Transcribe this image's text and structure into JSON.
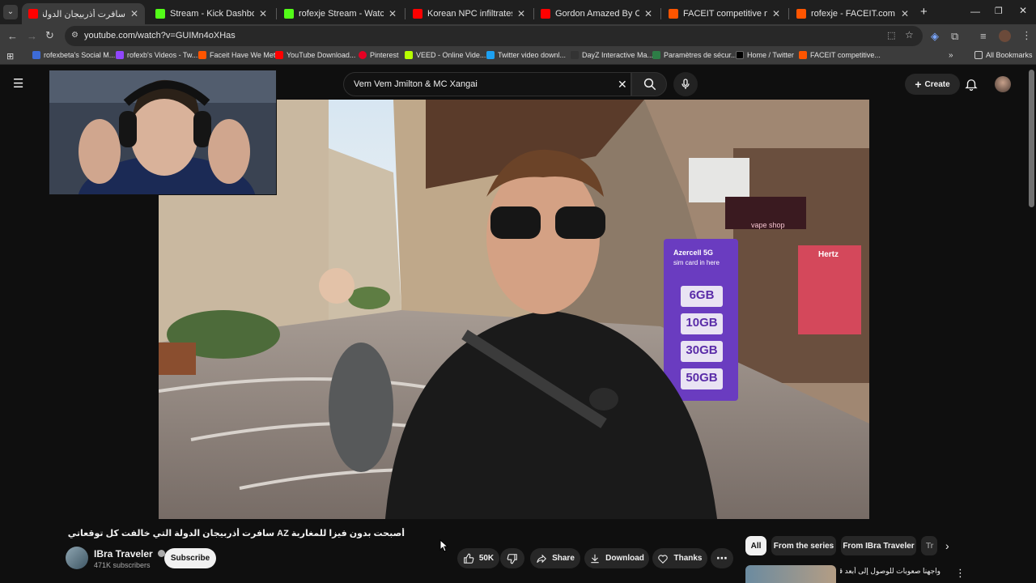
{
  "browser": {
    "tabs": [
      {
        "title": "سافرت أذربيجان الدولة التي خالف",
        "favicon_color": "#ff0000",
        "active": true
      },
      {
        "title": "Stream - Kick Dashboard",
        "favicon_color": "#53fc18",
        "active": false
      },
      {
        "title": "rofexje Stream - Watch Live on",
        "favicon_color": "#53fc18",
        "active": false
      },
      {
        "title": "Korean NPC infiltrates Sony HQ",
        "favicon_color": "#ff0000",
        "active": false
      },
      {
        "title": "Gordon Amazed By Chef Who H",
        "favicon_color": "#ff0000",
        "active": false
      },
      {
        "title": "FACEIT competitive match - FA",
        "favicon_color": "#ff5500",
        "active": false
      },
      {
        "title": "rofexje - FACEIT.com",
        "favicon_color": "#ff5500",
        "active": false
      }
    ],
    "new_tab_label": "+",
    "url": "youtube.com/watch?v=GUIMn4oXHas",
    "bookmarks": [
      {
        "label": "rofexbeta's Social M...",
        "color": "#3d6bd6"
      },
      {
        "label": "rofexb's Videos - Tw...",
        "color": "#9146ff"
      },
      {
        "label": "Faceit Have We Met",
        "color": "#ff5500"
      },
      {
        "label": "YouTube Download...",
        "color": "#ff0000"
      },
      {
        "label": "Pinterest",
        "color": "#e60023"
      },
      {
        "label": "VEED - Online Vide...",
        "color": "#b6ff00"
      },
      {
        "label": "Twitter video downl...",
        "color": "#1da1f2"
      },
      {
        "label": "DayZ Interactive Ma...",
        "color": "#333333"
      },
      {
        "label": "Paramètres de sécur...",
        "color": "#2d7d46"
      },
      {
        "label": "Home / Twitter",
        "color": "#000000"
      },
      {
        "label": "FACEIT competitive...",
        "color": "#ff5500"
      }
    ],
    "all_bookmarks": "All Bookmarks"
  },
  "youtube": {
    "search_query": "Vem Vem Jmilton & MC Xangai",
    "create_label": "Create",
    "video_overlay": {
      "sign_sizes": [
        "6GB",
        "10GB",
        "30GB",
        "50GB"
      ],
      "brand_sign": "Azercell 5G",
      "sim_text": "sim card in here",
      "hertz_sign": "Hertz",
      "shop_sign": "vape shop"
    },
    "video_title": "أصبحت بدون فيزا للمغاربة AZ سافرت أذربيجان الدولة التي خالفت كل توقعاتي تماما MA",
    "channel_name": "IBra Traveler",
    "subscribers": "471K subscribers",
    "subscribe_label": "Subscribe",
    "like_count": "50K",
    "share_label": "Share",
    "download_label": "Download",
    "thanks_label": "Thanks",
    "chips": [
      "All",
      "From the series",
      "From IBra Traveler",
      "Tr"
    ],
    "recommended_title": "واجهنا صعوبات للوصول إلى أبعد قرية"
  }
}
